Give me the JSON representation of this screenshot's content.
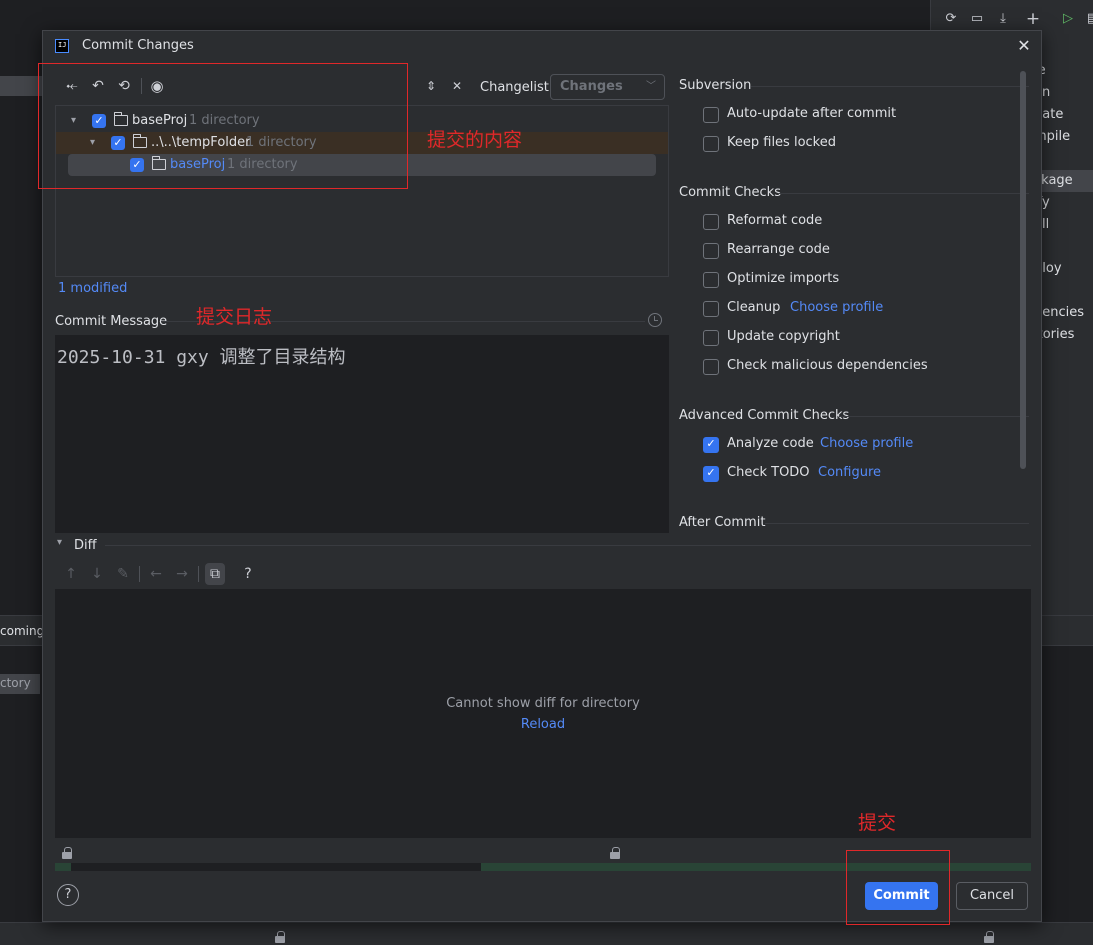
{
  "background": {
    "left_items": [
      "coming",
      "ctory"
    ],
    "right_items": [
      "le",
      "an",
      "date",
      "mpile",
      "t",
      "ckage",
      "ify",
      "all",
      "·",
      "ploy",
      "s",
      "dencies",
      "itories"
    ],
    "right_selected_index": 5
  },
  "dialog": {
    "title": "Commit Changes",
    "app_icon_text": "IJ",
    "close_glyph": "✕"
  },
  "toolbar": {
    "icons": [
      "shelve-icon",
      "undo-icon",
      "refresh-icon",
      "eye-icon"
    ],
    "expand_icon": "expand-all-icon",
    "collapse_icon": "collapse-all-icon"
  },
  "changelist": {
    "label": "Changelist:",
    "selected": "Changes"
  },
  "tree": {
    "rows": [
      {
        "name": "baseProj",
        "meta": "1 directory",
        "checked": true
      },
      {
        "name": "..\\..\\tempFolder",
        "meta": "1 directory",
        "checked": true
      },
      {
        "name": "baseProj",
        "meta": "1 directory",
        "checked": true
      }
    ]
  },
  "status": {
    "modified": "1 modified"
  },
  "commit_message": {
    "label": "Commit Message",
    "text": "2025-10-31 gxy 调整了目录结构"
  },
  "right_panel": {
    "subversion": {
      "title": "Subversion",
      "options": [
        {
          "label": "Auto-update after commit",
          "checked": false
        },
        {
          "label": "Keep files locked",
          "checked": false
        }
      ]
    },
    "commit_checks": {
      "title": "Commit Checks",
      "options": [
        {
          "label": "Reformat code",
          "checked": false
        },
        {
          "label": "Rearrange code",
          "checked": false
        },
        {
          "label": "Optimize imports",
          "checked": false
        },
        {
          "label": "Cleanup",
          "checked": false,
          "link": "Choose profile"
        },
        {
          "label": "Update copyright",
          "checked": false
        },
        {
          "label": "Check malicious dependencies",
          "checked": false
        }
      ]
    },
    "advanced": {
      "title": "Advanced Commit Checks",
      "options": [
        {
          "label": "Analyze code",
          "checked": true,
          "link": "Choose profile"
        },
        {
          "label": "Check TODO",
          "checked": true,
          "link": "Configure"
        }
      ]
    },
    "after_commit": {
      "title": "After Commit"
    }
  },
  "diff": {
    "title": "Diff",
    "message": "Cannot show diff for directory",
    "reload": "Reload",
    "help_glyph": "?"
  },
  "buttons": {
    "help": "?",
    "commit": "Commit",
    "cancel": "Cancel"
  },
  "annotations": {
    "content": "提交的内容",
    "log": "提交日志",
    "commit": "提交",
    "color": "#e0282a"
  }
}
